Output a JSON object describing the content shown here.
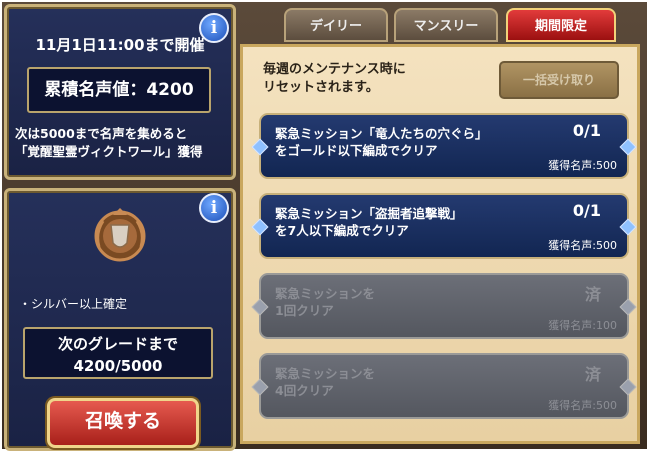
{
  "event": {
    "deadline": "11月1日11:00まで開催",
    "fame": "累積名声値：4200",
    "notice_line1": "次は5000まで名声を集めると",
    "notice_line2": "「覚醒聖霊ヴィクトワール」獲得"
  },
  "grade": {
    "guarantee": "・シルバー以上確定",
    "next_label": "次のグレードまで",
    "next_value": "4200/5000",
    "summon_label": "召喚する"
  },
  "tabs": [
    {
      "label": "デイリー",
      "active": false
    },
    {
      "label": "マンスリー",
      "active": false
    },
    {
      "label": "期間限定",
      "active": true
    }
  ],
  "panel": {
    "reset_line1": "毎週のメンテナンス時に",
    "reset_line2": "リセットされます。",
    "bulk_claim": "一括受け取り"
  },
  "missions": [
    {
      "line1": "緊急ミッション「竜人たちの穴ぐら」",
      "line2": "をゴールド以下編成でクリア",
      "progress": "0/1",
      "reward": "獲得名声:500",
      "done": false
    },
    {
      "line1": "緊急ミッション「盗掘者追撃戦」",
      "line2": "を7人以下編成でクリア",
      "progress": "0/1",
      "reward": "獲得名声:500",
      "done": false
    },
    {
      "line1": "緊急ミッションを",
      "line2": "1回クリア",
      "progress": "済",
      "reward": "獲得名声:100",
      "done": true
    },
    {
      "line1": "緊急ミッションを",
      "line2": "4回クリア",
      "progress": "済",
      "reward": "獲得名声:500",
      "done": true
    }
  ],
  "icons": {
    "info": "info-icon",
    "medal": "silver-medal-icon"
  },
  "colors": {
    "active_tab": "#d0201c",
    "panel_bg": "#1f2a52",
    "mission_bg": "#1a3060"
  }
}
